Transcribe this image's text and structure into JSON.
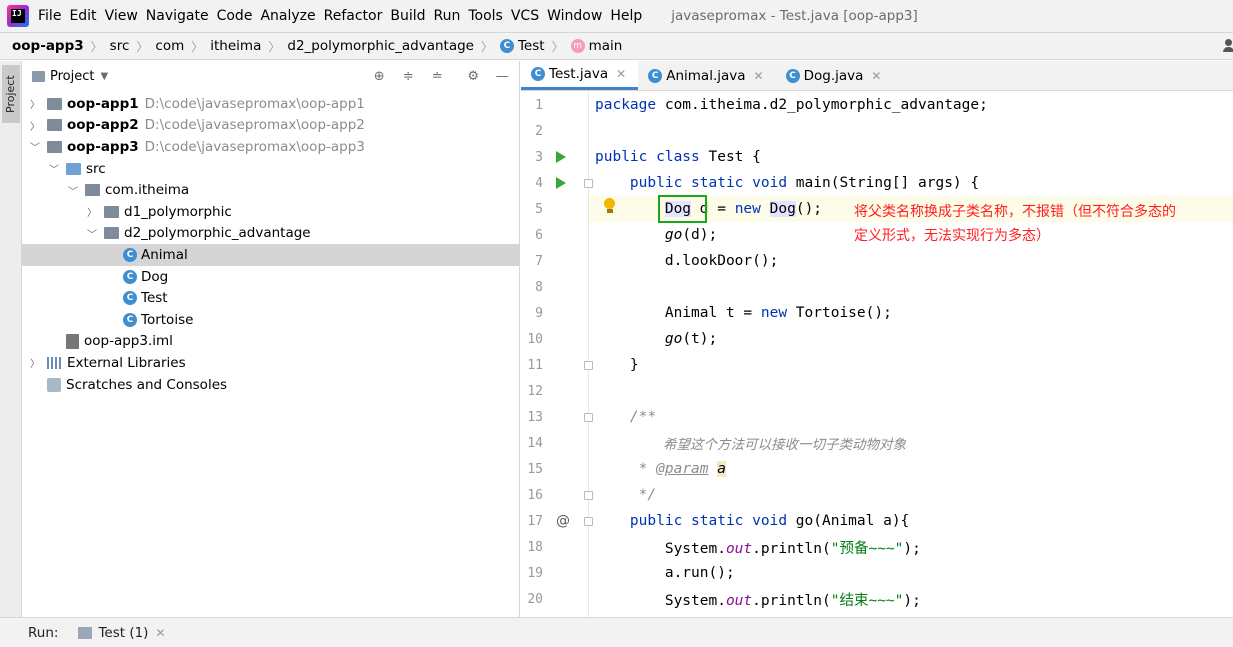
{
  "menubar": {
    "items": [
      "File",
      "Edit",
      "View",
      "Navigate",
      "Code",
      "Analyze",
      "Refactor",
      "Build",
      "Run",
      "Tools",
      "VCS",
      "Window",
      "Help"
    ],
    "window_title": "javasepromax - Test.java [oop-app3]"
  },
  "breadcrumb": [
    "oop-app3",
    "src",
    "com",
    "itheima",
    "d2_polymorphic_advantage",
    "Test",
    "main"
  ],
  "sidebar_stripe_label": "Project",
  "project_panel": {
    "title": "Project",
    "tree": [
      {
        "label": "oop-app1",
        "path": "D:\\code\\javasepromax\\oop-app1"
      },
      {
        "label": "oop-app2",
        "path": "D:\\code\\javasepromax\\oop-app2"
      },
      {
        "label": "oop-app3",
        "path": "D:\\code\\javasepromax\\oop-app3"
      },
      {
        "label": "src"
      },
      {
        "label": "com.itheima"
      },
      {
        "label": "d1_polymorphic"
      },
      {
        "label": "d2_polymorphic_advantage"
      },
      {
        "label": "Animal"
      },
      {
        "label": "Dog"
      },
      {
        "label": "Test"
      },
      {
        "label": "Tortoise"
      },
      {
        "label": "oop-app3.iml"
      },
      {
        "label": "External Libraries"
      },
      {
        "label": "Scratches and Consoles"
      }
    ]
  },
  "editor_tabs": [
    "Test.java",
    "Animal.java",
    "Dog.java"
  ],
  "code": {
    "line_numbers": [
      "1",
      "2",
      "3",
      "4",
      "5",
      "6",
      "7",
      "8",
      "9",
      "10",
      "11",
      "12",
      "13",
      "14",
      "15",
      "16",
      "17",
      "18",
      "19",
      "20"
    ],
    "l1_kw": "package",
    "l1_rest": " com.itheima.d2_polymorphic_advantage;",
    "l3_kw": "public class",
    "l3_rest": " Test {",
    "l4_kw": "public static void",
    "l4_rest": " main(String[] args) {",
    "l5_type": "Dog",
    "l5_mid": " d = ",
    "l5_kw": "new",
    "l5_dog": "Dog",
    "l5_end": "();",
    "l6_go": "go",
    "l6_rest": "(d);",
    "l7": "d.lookDoor();",
    "l9_a": "Animal t = ",
    "l9_kw": "new",
    "l9_b": " Tortoise();",
    "l10_go": "go",
    "l10_rest": "(t);",
    "l11": "}",
    "l13": "/**",
    "l14": "希望这个方法可以接收一切子类动物对象",
    "l15_star": "* ",
    "l15_tag": "@param",
    "l15_param": "a",
    "l16": "*/",
    "l17_kw": "public static void",
    "l17_rest": " go(Animal a){",
    "l18_a": "System.",
    "l18_out": "out",
    "l18_b": ".println(",
    "l18_str": "\"预备~~~\"",
    "l18_c": ");",
    "l19": "a.run();",
    "l20_a": "System.",
    "l20_out": "out",
    "l20_b": ".println(",
    "l20_str": "\"结束~~~\"",
    "l20_c": ");",
    "at_marker": "@"
  },
  "annotation": {
    "line1": "将父类名称换成子类名称，不报错（但不符合多态的",
    "line2": "定义形式，无法实现行为多态）",
    "color": "#ff2020",
    "box_color": "#1aa81a"
  },
  "run_bar": {
    "label": "Run:",
    "tab": "Test (1)"
  }
}
